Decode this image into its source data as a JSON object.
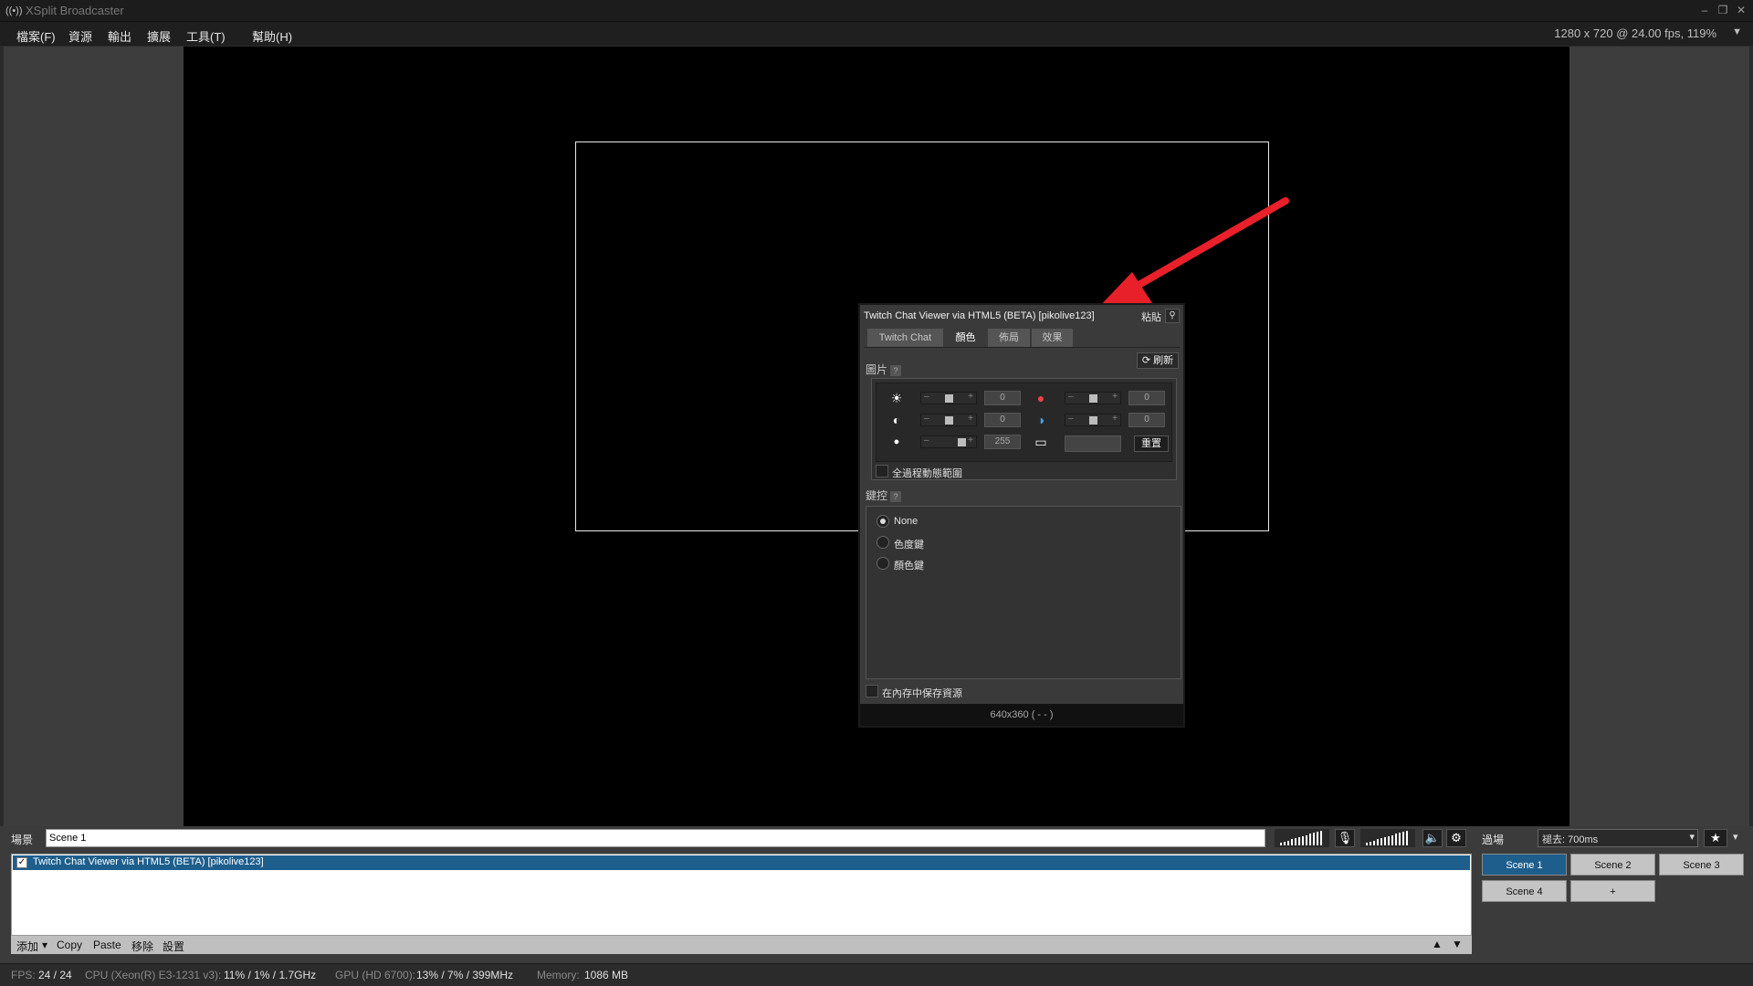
{
  "window": {
    "title": "XSplit Broadcaster",
    "minimize_label": "–",
    "restore_label": "❐",
    "close_label": "✕",
    "logo_glyph": "((•))"
  },
  "menu": {
    "items": [
      "檔案(F)",
      "資源",
      "輸出",
      "擴展",
      "工具(T)",
      "幫助(H)"
    ],
    "resolution_info": "1280 x 720 @ 24.00 fps, 119%",
    "resolution_arrow": "▼"
  },
  "dialog": {
    "title": "Twitch Chat Viewer via HTML5 (BETA) [pikolive123]",
    "paste_label": "粘貼",
    "pin_glyph": "⚲",
    "tabs": [
      "Twitch Chat",
      "顏色",
      "佈局",
      "效果"
    ],
    "active_tab": 1,
    "image_section_label": "圖片",
    "help_glyph": "?",
    "refresh_label": "⟳ 刷新",
    "adjustments": {
      "brightness": {
        "value": "0",
        "icon": "☀"
      },
      "contrast": {
        "value": "0",
        "icon": "◐"
      },
      "opacity": {
        "value": "255",
        "icon": "●"
      },
      "hue": {
        "value": "0",
        "icon": "●"
      },
      "saturation": {
        "value": "0",
        "icon": "◑"
      },
      "gamma_icon": "▭"
    },
    "slider_minus": "–",
    "slider_plus": "+",
    "reset_label": "重置",
    "full_range_label": "全過程動態範圍",
    "keying_section_label": "鍵控",
    "keying_options": [
      "None",
      "色度鍵",
      "顏色鍵"
    ],
    "keying_selected": "None",
    "keep_in_memory_label": "在內存中保存資源",
    "footer": "640x360 ( - - )"
  },
  "bottom": {
    "scene_label": "場景",
    "scene_name": "Scene 1",
    "sources": [
      {
        "label": "Twitch Chat Viewer via HTML5 (BETA) [pikolive123]",
        "checked": true,
        "check_glyph": "✓"
      }
    ],
    "toolbar": {
      "add": "添加",
      "add_arrow": "▾",
      "copy": "Copy",
      "paste": "Paste",
      "remove": "移除",
      "settings": "設置",
      "up_arrow": "▲",
      "down_arrow": "▼"
    },
    "mic_mute_glyph": "🎙",
    "speaker_glyph": "🔈",
    "settings_glyph": "⚙",
    "transition_label": "過場",
    "transition_value": "褪去: 700ms",
    "dropdown_arrow": "▾",
    "add_scene_icon_glyph": "★",
    "scenes": [
      "Scene 1",
      "Scene 2",
      "Scene 3",
      "Scene 4",
      "+"
    ],
    "active_scene": "Scene 1",
    "accent_color": "#1d5e8d"
  },
  "status": {
    "fps_label": "FPS:",
    "fps_value": "24 / 24",
    "cpu_label": "CPU (Xeon(R) E3-1231 v3):",
    "cpu_value": "11% / 1% / 1.7GHz",
    "gpu_label": "GPU (HD 6700):",
    "gpu_value": "13% / 7% / 399MHz",
    "memory_label": "Memory:",
    "memory_value": "1086 MB"
  }
}
